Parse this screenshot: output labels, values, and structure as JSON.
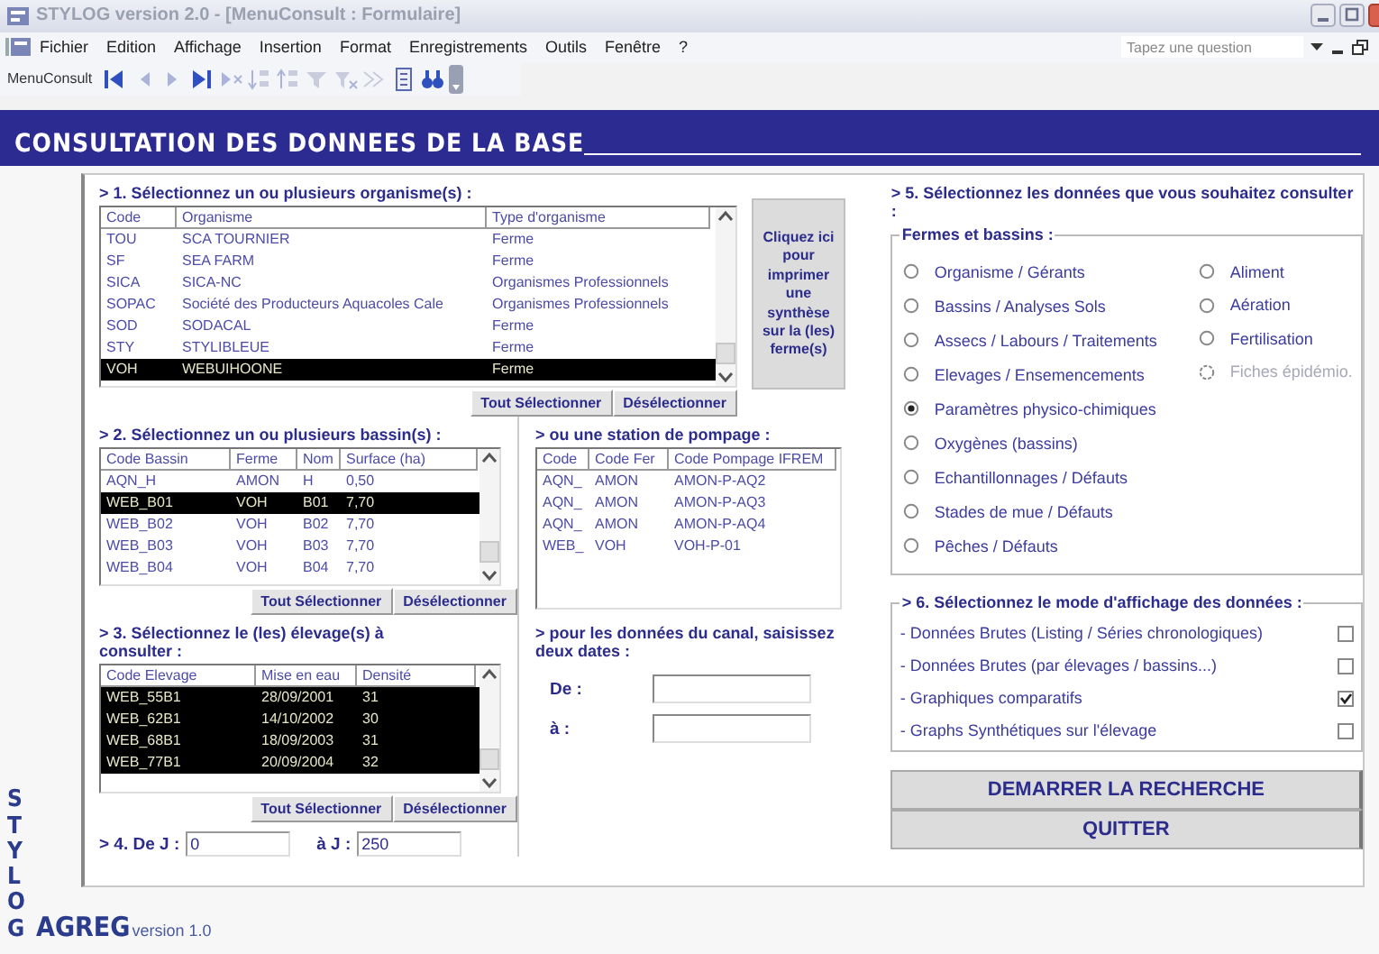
{
  "window": {
    "title": "STYLOG version 2.0 - [MenuConsult : Formulaire]"
  },
  "menu": [
    "Fichier",
    "Edition",
    "Affichage",
    "Insertion",
    "Format",
    "Enregistrements",
    "Outils",
    "Fenêtre",
    "?"
  ],
  "help_search": {
    "placeholder": "Tapez une question"
  },
  "toolbar": {
    "name": "MenuConsult"
  },
  "header": {
    "title": "CONSULTATION DES DONNEES DE LA BASE"
  },
  "organisms": {
    "heading": "> 1. Sélectionnez un ou plusieurs organisme(s) :",
    "columns": [
      "Code",
      "Organisme",
      "Type d'organisme"
    ],
    "rows": [
      {
        "cells": [
          "TOU",
          "SCA TOURNIER",
          "Ferme"
        ],
        "selected": false
      },
      {
        "cells": [
          "SF",
          "SEA FARM",
          "Ferme"
        ],
        "selected": false
      },
      {
        "cells": [
          "SICA",
          "SICA-NC",
          "Organismes Professionnels"
        ],
        "selected": false
      },
      {
        "cells": [
          "SOPAC",
          "Société des Producteurs Aquacoles Cale",
          "Organismes Professionnels"
        ],
        "selected": false
      },
      {
        "cells": [
          "SOD",
          "SODACAL",
          "Ferme"
        ],
        "selected": false
      },
      {
        "cells": [
          "STY",
          "STYLIBLEUE",
          "Ferme"
        ],
        "selected": false
      },
      {
        "cells": [
          "VOH",
          "WEBUIHOONE",
          "Ferme"
        ],
        "selected": true
      }
    ],
    "buttons": [
      "Tout Sélectionner",
      "Désélectionner"
    ]
  },
  "print_button": "Cliquez ici pour imprimer une synthèse sur la (les) ferme(s)",
  "basins": {
    "heading": "> 2. Sélectionnez un ou plusieurs bassin(s) :",
    "columns": [
      "Code Bassin",
      "Ferme",
      "Nom",
      "Surface (ha)"
    ],
    "rows": [
      {
        "cells": [
          "AQN_H",
          "AMON",
          "H",
          "0,50"
        ],
        "selected": false
      },
      {
        "cells": [
          "WEB_B01",
          "VOH",
          "B01",
          "7,70"
        ],
        "selected": true
      },
      {
        "cells": [
          "WEB_B02",
          "VOH",
          "B02",
          "7,70"
        ],
        "selected": false
      },
      {
        "cells": [
          "WEB_B03",
          "VOH",
          "B03",
          "7,70"
        ],
        "selected": false
      },
      {
        "cells": [
          "WEB_B04",
          "VOH",
          "B04",
          "7,70"
        ],
        "selected": false
      }
    ],
    "buttons": [
      "Tout Sélectionner",
      "Désélectionner"
    ]
  },
  "pumps": {
    "heading": "> ou une station de pompage :",
    "columns": [
      "Code",
      "Code Fer",
      "Code Pompage IFREM"
    ],
    "rows": [
      {
        "cells": [
          "AQN_",
          "AMON",
          "AMON-P-AQ2"
        ],
        "selected": false
      },
      {
        "cells": [
          "AQN_",
          "AMON",
          "AMON-P-AQ3"
        ],
        "selected": false
      },
      {
        "cells": [
          "AQN_",
          "AMON",
          "AMON-P-AQ4"
        ],
        "selected": false
      },
      {
        "cells": [
          "WEB_",
          "VOH",
          "VOH-P-01"
        ],
        "selected": false
      }
    ]
  },
  "rearings": {
    "heading": "> 3. Sélectionnez le (les) élevage(s) à consulter :",
    "columns": [
      "Code Elevage",
      "Mise en eau",
      "Densité"
    ],
    "rows": [
      {
        "cells": [
          "WEB_55B1",
          "28/09/2001",
          "31"
        ],
        "selected": true
      },
      {
        "cells": [
          "WEB_62B1",
          "14/10/2002",
          "30"
        ],
        "selected": true
      },
      {
        "cells": [
          "WEB_68B1",
          "18/09/2003",
          "31"
        ],
        "selected": true
      },
      {
        "cells": [
          "WEB_77B1",
          "20/09/2004",
          "32"
        ],
        "selected": true
      }
    ],
    "buttons": [
      "Tout Sélectionner",
      "Désélectionner"
    ]
  },
  "days": {
    "from_label": "> 4. De J :",
    "from": "0",
    "to_label": "à J :",
    "to": "250"
  },
  "canal": {
    "heading": "> pour les données du canal, saisissez deux dates :",
    "from_label": "De :",
    "to_label": "à :"
  },
  "data_types": {
    "heading": "> 5. Sélectionnez les données que vous souhaitez consulter :",
    "legend": "Fermes et bassins :",
    "left": [
      {
        "label": "Organisme / Gérants",
        "selected": false,
        "disabled": false
      },
      {
        "label": "Bassins / Analyses Sols",
        "selected": false,
        "disabled": false
      },
      {
        "label": "Assecs / Labours / Traitements",
        "selected": false,
        "disabled": false
      },
      {
        "label": "Elevages / Ensemencements",
        "selected": false,
        "disabled": false
      },
      {
        "label": "Paramètres physico-chimiques",
        "selected": true,
        "disabled": false
      },
      {
        "label": "Oxygènes (bassins)",
        "selected": false,
        "disabled": false
      },
      {
        "label": "Echantillonnages / Défauts",
        "selected": false,
        "disabled": false
      },
      {
        "label": "Stades de mue / Défauts",
        "selected": false,
        "disabled": false
      },
      {
        "label": "Pêches / Défauts",
        "selected": false,
        "disabled": false
      }
    ],
    "right": [
      {
        "label": "Aliment",
        "selected": false,
        "disabled": false
      },
      {
        "label": "Aération",
        "selected": false,
        "disabled": false
      },
      {
        "label": "Fertilisation",
        "selected": false,
        "disabled": false
      },
      {
        "label": "Fiches épidémio.",
        "selected": false,
        "disabled": true
      }
    ]
  },
  "display": {
    "legend": "> 6. Sélectionnez le mode d'affichage des données :",
    "options": [
      {
        "label": "- Données Brutes (Listing / Séries chronologiques)",
        "checked": false
      },
      {
        "label": "- Données Brutes (par élevages / bassins...)",
        "checked": false
      },
      {
        "label": "- Graphiques comparatifs",
        "checked": true
      },
      {
        "label": "- Graphs Synthétiques sur l'élevage",
        "checked": false
      }
    ]
  },
  "actions": [
    "DEMARRER LA RECHERCHE",
    "QUITTER"
  ],
  "logo": {
    "vertical": "STYLOG",
    "name": "AGREG",
    "version": "version 1.0"
  }
}
